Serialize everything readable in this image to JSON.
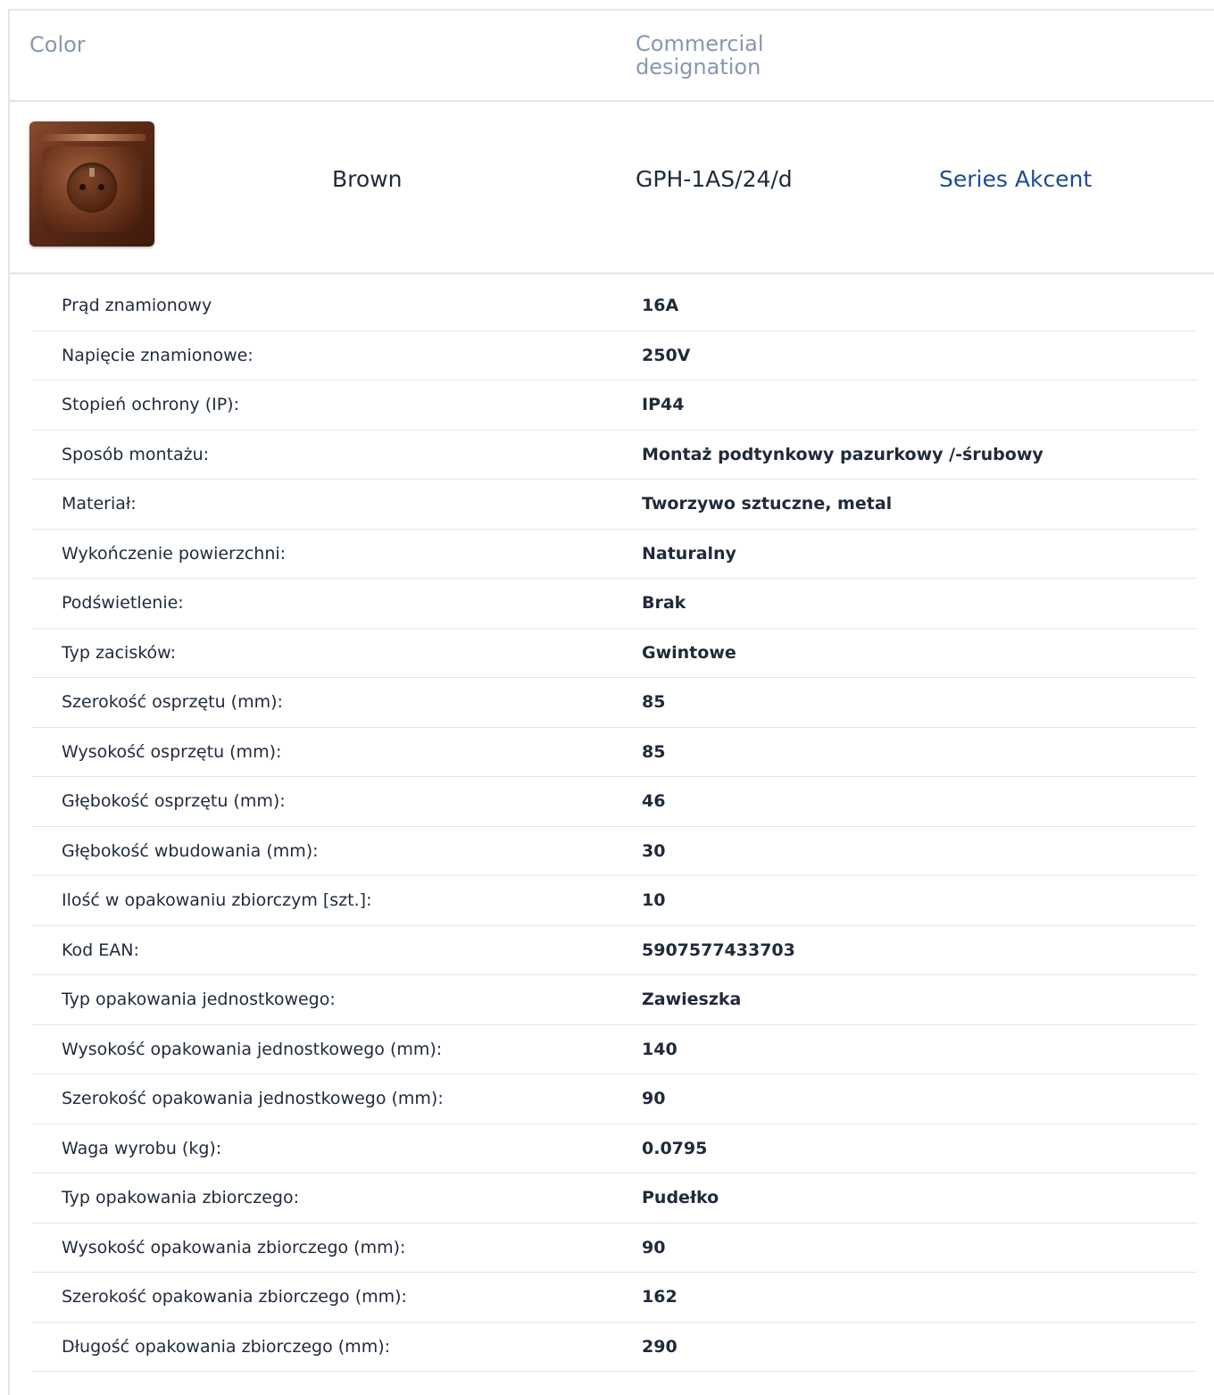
{
  "header": {
    "color_label": "Color",
    "commercial_label": "Commercial designation"
  },
  "product": {
    "color_name": "Brown",
    "designation": "GPH-1AS/24/d",
    "series_link": "Series Akcent",
    "image_icon": "brown-socket-thumbnail",
    "link_color": "#1f4b8f"
  },
  "specs": [
    {
      "label": "Prąd znamionowy",
      "value": "16A"
    },
    {
      "label": "Napięcie znamionowe:",
      "value": "250V"
    },
    {
      "label": "Stopień ochrony (IP):",
      "value": "IP44"
    },
    {
      "label": "Sposób montażu:",
      "value": "Montaż podtynkowy pazurkowy /-śrubowy"
    },
    {
      "label": "Materiał:",
      "value": "Tworzywo sztuczne, metal"
    },
    {
      "label": "Wykończenie powierzchni:",
      "value": "Naturalny"
    },
    {
      "label": "Podświetlenie:",
      "value": "Brak"
    },
    {
      "label": "Typ zacisków:",
      "value": "Gwintowe"
    },
    {
      "label": "Szerokość osprzętu (mm):",
      "value": "85"
    },
    {
      "label": "Wysokość osprzętu (mm):",
      "value": "85"
    },
    {
      "label": "Głębokość osprzętu (mm):",
      "value": "46"
    },
    {
      "label": "Głębokość wbudowania (mm):",
      "value": "30"
    },
    {
      "label": "Ilość w opakowaniu zbiorczym [szt.]:",
      "value": "10"
    },
    {
      "label": "Kod EAN:",
      "value": "5907577433703"
    },
    {
      "label": "Typ opakowania jednostkowego:",
      "value": "Zawieszka"
    },
    {
      "label": "Wysokość opakowania jednostkowego (mm):",
      "value": "140"
    },
    {
      "label": "Szerokość opakowania jednostkowego (mm):",
      "value": "90"
    },
    {
      "label": "Waga wyrobu (kg):",
      "value": "0.0795"
    },
    {
      "label": "Typ opakowania zbiorczego:",
      "value": "Pudełko"
    },
    {
      "label": "Wysokość opakowania zbiorczego (mm):",
      "value": "90"
    },
    {
      "label": "Szerokość opakowania zbiorczego (mm):",
      "value": "162"
    },
    {
      "label": "Długość opakowania zbiorczego (mm):",
      "value": "290"
    }
  ]
}
